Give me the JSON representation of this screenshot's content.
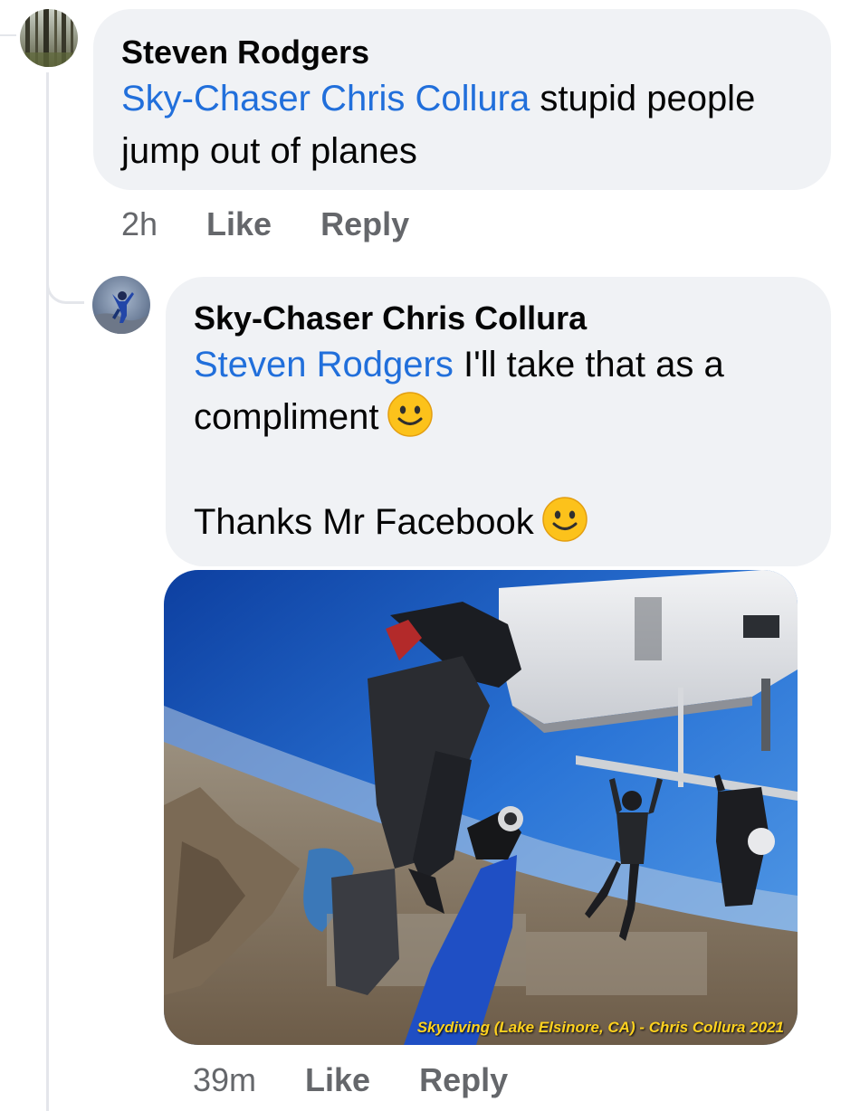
{
  "comments": [
    {
      "author": "Steven Rodgers",
      "mention": "Sky-Chaser Chris Collura",
      "text": " stupid people jump out of planes",
      "time": "2h",
      "like_label": "Like",
      "reply_label": "Reply",
      "avatar_icon": "forest-avatar"
    },
    {
      "author": "Sky-Chaser Chris Collura",
      "mention": "Steven Rodgers",
      "text": " I'll take that as a compliment",
      "text2": "Thanks Mr Facebook",
      "emoji": "slightly-smiling-face",
      "time": "39m",
      "like_label": "Like",
      "reply_label": "Reply",
      "avatar_icon": "skydiver-avatar",
      "photo": {
        "description_icon": "skydiving-photo",
        "watermark": "Skydiving (Lake Elsinore, CA) - Chris Collura 2021"
      }
    }
  ],
  "colors": {
    "bubble": "#f0f2f5",
    "mention": "#216fdb",
    "action": "#65676b"
  }
}
